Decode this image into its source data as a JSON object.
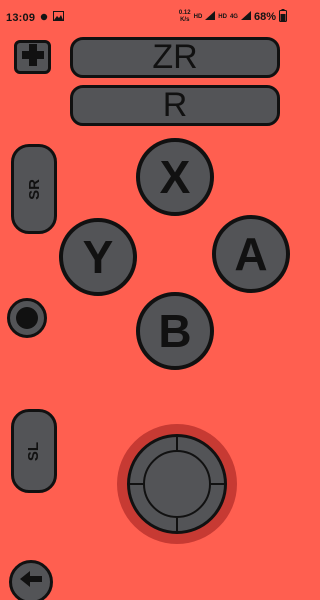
{
  "status_bar": {
    "time": "13:09",
    "speed_value": "0.12",
    "speed_unit": "K/s",
    "net_label_1": "HD",
    "net_label_2": "HD",
    "net_label_3": "4G",
    "battery_percent": "68%"
  },
  "controller": {
    "zr_label": "ZR",
    "r_label": "R",
    "sr_label": "SR",
    "sl_label": "SL",
    "x_label": "X",
    "y_label": "Y",
    "a_label": "A",
    "b_label": "B"
  },
  "colors": {
    "background": "#ff5f50",
    "button_fill": "#535457",
    "outline": "#111111",
    "joystick_base": "#c73a33"
  },
  "icons": {
    "plus": "plus-icon",
    "home_dot": "dot-icon",
    "back": "arrow-left-icon"
  }
}
